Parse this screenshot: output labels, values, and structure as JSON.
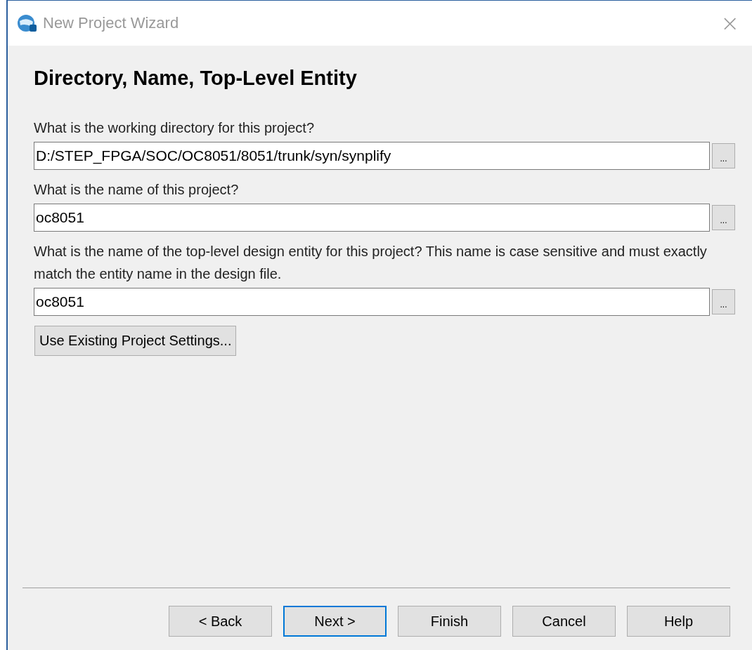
{
  "window": {
    "title": "New Project Wizard",
    "close": "×"
  },
  "heading": "Directory, Name, Top-Level Entity",
  "fields": [
    {
      "label": "What is the working directory for this project?",
      "value": "D:/STEP_FPGA/SOC/OC8051/8051/trunk/syn/synplify",
      "browse": "..."
    },
    {
      "label": "What is the name of this project?",
      "value": "oc8051",
      "browse": "..."
    },
    {
      "label": "What is the name of the top-level design entity for this project? This name is case sensitive and must exactly match the entity name in the design file.",
      "value": "oc8051",
      "browse": "..."
    }
  ],
  "settings_button": "Use Existing Project Settings...",
  "buttons": [
    {
      "label": "< Back",
      "focused": false
    },
    {
      "label": "Next >",
      "focused": true
    },
    {
      "label": "Finish",
      "focused": false
    },
    {
      "label": "Cancel",
      "focused": false
    },
    {
      "label": "Help",
      "focused": false
    }
  ]
}
